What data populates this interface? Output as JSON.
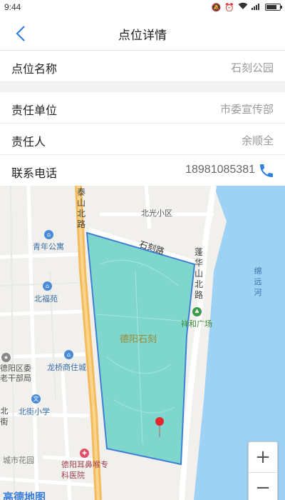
{
  "status_bar": {
    "time": "9:44"
  },
  "header": {
    "title": "点位详情"
  },
  "point": {
    "label": "点位名称",
    "value": "石刻公园"
  },
  "responsibility": {
    "unit_label": "责任单位",
    "unit_value": "市委宣传部",
    "person_label": "责任人",
    "person_value": "余顺全",
    "phone_label": "联系电话",
    "phone_value": "18981085381"
  },
  "map": {
    "labels": {
      "taishan_road": "泰山北路",
      "beiguang": "北光小区",
      "shike_road": "石刻路",
      "penghua_road": "蓬华山北路",
      "qingnian": "青年公寓",
      "mianyuan": "绵远河",
      "beifu": "北福苑",
      "xianghe": "祥和广场",
      "deyang_shike": "德阳石刻",
      "deyang_cadre": "德阳区委老干部局",
      "longqiao": "龙桥商住城",
      "beijie_school": "北街小学",
      "bei": "北街",
      "chengshi": "城市花园",
      "hospital": "德阳耳鼻喉专科医院",
      "logo": "高德地图"
    },
    "zoom_in": "+",
    "zoom_out": "−"
  },
  "colors": {
    "accent": "#2f80e0",
    "area_fill": "#7fd6cc",
    "area_stroke": "#3f7fd6",
    "water": "#9ed2f5",
    "main_road": "#f4bb5c",
    "marker": "#e0262c"
  }
}
